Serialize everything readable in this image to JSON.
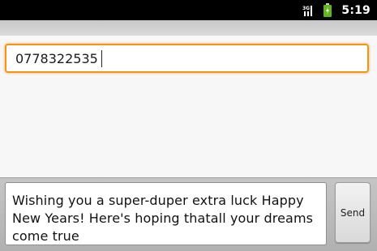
{
  "status_bar": {
    "time": "5:19",
    "icons": [
      "signal-icon",
      "battery-icon"
    ],
    "battery_color": "#5fb51a"
  },
  "recipient": {
    "value": "0778322535"
  },
  "message": {
    "text": "Wishing you a super-duper extra luck Happy New Years! Here's hoping thatall your dreams come true"
  },
  "send_button": {
    "label": "Send"
  },
  "colors": {
    "focus_border": "#f0941c",
    "status_bar_bg": "#000000"
  }
}
